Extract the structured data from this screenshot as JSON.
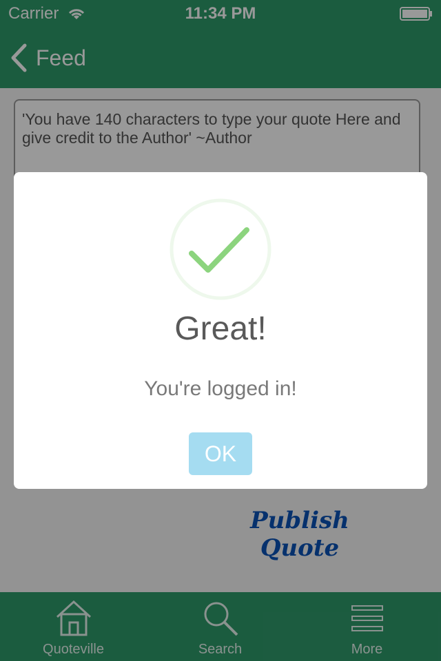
{
  "status": {
    "carrier": "Carrier",
    "time": "11:34 PM"
  },
  "nav": {
    "back_label": "Feed"
  },
  "quote": {
    "placeholder": "'You have 140 characters to type your quote Here and give credit to the Author'  ~Author"
  },
  "publish_label": "Publish Quote",
  "tabs": [
    {
      "label": "Quoteville",
      "icon": "home-icon"
    },
    {
      "label": "Search",
      "icon": "search-icon"
    },
    {
      "label": "More",
      "icon": "menu-icon"
    }
  ],
  "alert": {
    "title": "Great!",
    "message": "You're logged in!",
    "button_label": "OK"
  },
  "colors": {
    "bar_green": "#2e9a6a",
    "publish_blue": "#0b53b6",
    "ok_blue": "#a5dcf1",
    "check_green": "#8cd47e"
  }
}
